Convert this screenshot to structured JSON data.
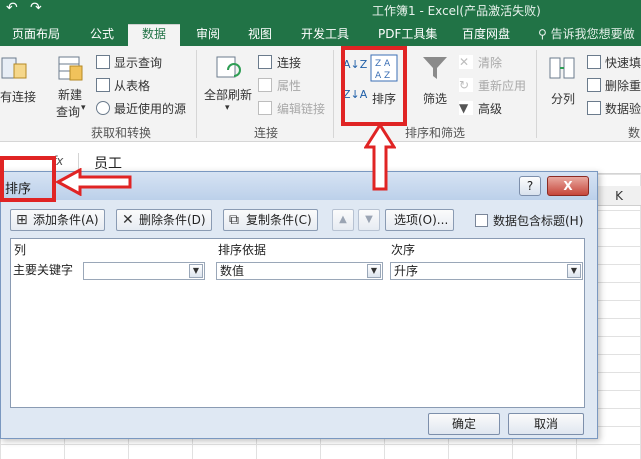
{
  "window": {
    "title": "工作簿1 - Excel(产品激活失败)"
  },
  "tabs": [
    {
      "label": "页面布局",
      "active": false
    },
    {
      "label": "公式",
      "active": false
    },
    {
      "label": "数据",
      "active": true
    },
    {
      "label": "审阅",
      "active": false
    },
    {
      "label": "视图",
      "active": false
    },
    {
      "label": "开发工具",
      "active": false
    },
    {
      "label": "PDF工具集",
      "active": false
    },
    {
      "label": "百度网盘",
      "active": false
    }
  ],
  "tell_me": "告诉我您想要做",
  "ribbon": {
    "existing_connections": "有连接",
    "new_query_1": "新建",
    "new_query_2": "查询",
    "show_queries": "显示查询",
    "from_table": "从表格",
    "recent_sources": "最近使用的源",
    "group_get_transform": "获取和转换",
    "refresh_all": "全部刷新",
    "connections": "连接",
    "properties": "属性",
    "edit_links": "编辑链接",
    "group_connections": "连接",
    "sort": "排序",
    "filter": "筛选",
    "clear": "清除",
    "reapply": "重新应用",
    "advanced": "高级",
    "group_sort_filter": "排序和筛选",
    "split": "分列",
    "flash_fill": "快速填",
    "remove_dup": "删除重",
    "validation": "数据验",
    "group_data_tools_partial": "数"
  },
  "formula_bar": {
    "fx": "fx",
    "value": "员工"
  },
  "sheet": {
    "column_k": "K"
  },
  "dialog": {
    "title": "排序",
    "help_btn": "?",
    "close_btn": "X",
    "add_level": "添加条件(A)",
    "delete_level": "删除条件(D)",
    "copy_level": "复制条件(C)",
    "move_up": "▲",
    "move_down": "▼",
    "options": "选项(O)...",
    "has_headers": "数据包含标题(H)",
    "col_header_column": "列",
    "col_header_sort_on": "排序依据",
    "col_header_order": "次序",
    "row_label": "主要关键字",
    "row_column_value": "",
    "row_sort_on_value": "数值",
    "row_order_value": "升序",
    "ok": "确定",
    "cancel": "取消"
  }
}
